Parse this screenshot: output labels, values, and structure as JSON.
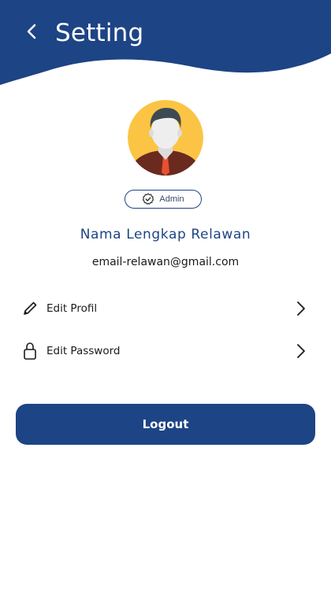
{
  "colors": {
    "primary": "#1d4484",
    "header_bg": "#1d4484",
    "text_dark": "#1a1a1a",
    "avatar_bg": "#fcc444",
    "background": "#ffffff"
  },
  "header": {
    "back_icon": "chevron-left-icon",
    "title": "Setting"
  },
  "profile": {
    "avatar_icon": "user-avatar",
    "role_icon": "verified-badge-icon",
    "role": "Admin",
    "name": "Nama Lengkap Relawan",
    "email": "email-relawan@gmail.com"
  },
  "menu": [
    {
      "icon": "pencil-icon",
      "label": "Edit Profil",
      "chevron": "chevron-right-icon"
    },
    {
      "icon": "lock-icon",
      "label": "Edit Password",
      "chevron": "chevron-right-icon"
    }
  ],
  "logout": {
    "label": "Logout"
  }
}
